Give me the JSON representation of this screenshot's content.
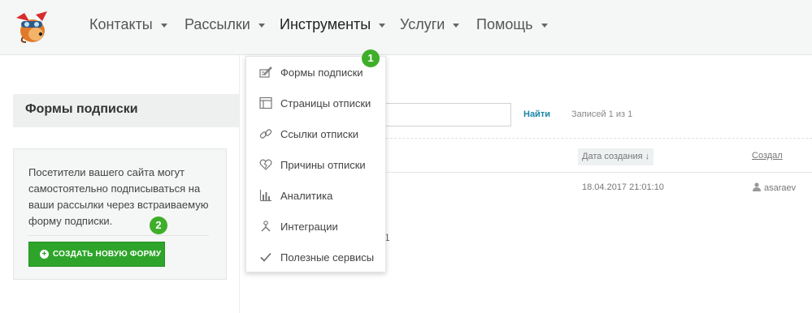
{
  "nav": {
    "items": [
      {
        "label": "Контакты"
      },
      {
        "label": "Рассылки"
      },
      {
        "label": "Инструменты"
      },
      {
        "label": "Услуги"
      },
      {
        "label": "Помощь"
      }
    ]
  },
  "tools_menu": {
    "items": [
      {
        "label": "Формы подписки",
        "icon": "form-edit-icon"
      },
      {
        "label": "Страницы отписки",
        "icon": "page-layout-icon"
      },
      {
        "label": "Ссылки отписки",
        "icon": "link-icon"
      },
      {
        "label": "Причины отписки",
        "icon": "broken-heart-icon"
      },
      {
        "label": "Аналитика",
        "icon": "bar-chart-icon"
      },
      {
        "label": "Интеграции",
        "icon": "integration-icon"
      },
      {
        "label": "Полезные сервисы",
        "icon": "checkmark-icon"
      }
    ]
  },
  "page": {
    "title": "Формы подписки"
  },
  "info": {
    "text": "Посетители вашего сайта могут самостоятельно подписываться на ваши рассылки через встраиваемую форму подписки.",
    "button_label": "СОЗДАТЬ НОВУЮ ФОРМУ"
  },
  "search": {
    "value": "",
    "find_label": "Найти",
    "records_text": "Записей 1 из 1"
  },
  "table": {
    "headers": {
      "date": "Дата создания ↓",
      "creator": "Создал"
    },
    "rows": [
      {
        "date": "18.04.2017 21:01:10",
        "creator": "asaraev"
      }
    ],
    "pager_fragment": "1"
  },
  "badges": [
    "1",
    "2"
  ],
  "colors": {
    "accent_green": "#2ea52a",
    "badge_green": "#3fae2a",
    "link_blue": "#1a86a8"
  }
}
